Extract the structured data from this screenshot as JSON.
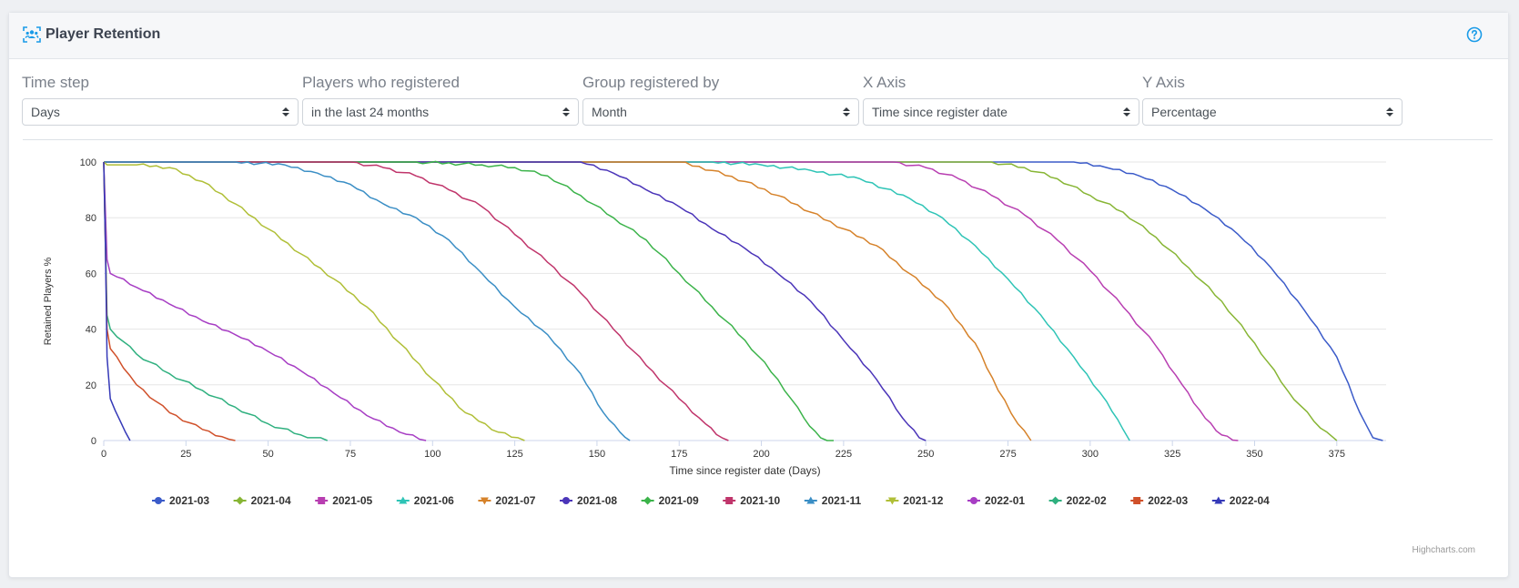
{
  "header": {
    "title": "Player Retention"
  },
  "filters": [
    {
      "label": "Time step",
      "value": "Days"
    },
    {
      "label": "Players who registered",
      "value": "in the last 24 months"
    },
    {
      "label": "Group registered by",
      "value": "Month"
    },
    {
      "label": "X Axis",
      "value": "Time since register date"
    },
    {
      "label": "Y Axis",
      "value": "Percentage"
    }
  ],
  "credits": "Highcharts.com",
  "chart_data": {
    "type": "line",
    "xlabel": "Time since register date (Days)",
    "ylabel": "Retained Players %",
    "xlim": [
      0,
      390
    ],
    "ylim": [
      0,
      100
    ],
    "xticks": [
      0,
      25,
      50,
      75,
      100,
      125,
      150,
      175,
      200,
      225,
      250,
      275,
      300,
      325,
      350,
      375
    ],
    "yticks": [
      0,
      20,
      40,
      60,
      80,
      100
    ],
    "grid": true,
    "legend_position": "bottom",
    "series": [
      {
        "name": "2021-03",
        "color": "#3b5bc9",
        "marker": "circle",
        "points": [
          [
            0,
            100
          ],
          [
            295,
            100
          ],
          [
            305,
            98
          ],
          [
            315,
            95
          ],
          [
            325,
            90
          ],
          [
            335,
            83
          ],
          [
            345,
            74
          ],
          [
            355,
            62
          ],
          [
            365,
            47
          ],
          [
            375,
            30
          ],
          [
            382,
            10
          ],
          [
            386,
            1
          ],
          [
            389,
            0
          ]
        ]
      },
      {
        "name": "2021-04",
        "color": "#87b534",
        "marker": "diamond",
        "points": [
          [
            0,
            100
          ],
          [
            270,
            100
          ],
          [
            280,
            98
          ],
          [
            290,
            94
          ],
          [
            300,
            88
          ],
          [
            310,
            82
          ],
          [
            320,
            73
          ],
          [
            330,
            62
          ],
          [
            340,
            50
          ],
          [
            350,
            35
          ],
          [
            360,
            18
          ],
          [
            368,
            7
          ],
          [
            374,
            1
          ],
          [
            375,
            0
          ]
        ]
      },
      {
        "name": "2021-05",
        "color": "#b83eb1",
        "marker": "square",
        "points": [
          [
            0,
            100
          ],
          [
            240,
            100
          ],
          [
            250,
            98
          ],
          [
            260,
            94
          ],
          [
            270,
            88
          ],
          [
            280,
            81
          ],
          [
            290,
            72
          ],
          [
            300,
            61
          ],
          [
            310,
            48
          ],
          [
            320,
            34
          ],
          [
            328,
            20
          ],
          [
            335,
            8
          ],
          [
            340,
            2
          ],
          [
            345,
            0
          ]
        ]
      },
      {
        "name": "2021-06",
        "color": "#2ec4b6",
        "marker": "triangle",
        "points": [
          [
            0,
            100
          ],
          [
            185,
            100
          ],
          [
            200,
            99
          ],
          [
            215,
            97
          ],
          [
            230,
            94
          ],
          [
            245,
            87
          ],
          [
            255,
            80
          ],
          [
            265,
            70
          ],
          [
            275,
            58
          ],
          [
            285,
            45
          ],
          [
            295,
            30
          ],
          [
            305,
            14
          ],
          [
            310,
            4
          ],
          [
            312,
            0
          ]
        ]
      },
      {
        "name": "2021-07",
        "color": "#d6822a",
        "marker": "triangle-down",
        "points": [
          [
            0,
            100
          ],
          [
            175,
            100
          ],
          [
            185,
            97
          ],
          [
            195,
            93
          ],
          [
            205,
            88
          ],
          [
            215,
            82
          ],
          [
            225,
            76
          ],
          [
            235,
            70
          ],
          [
            245,
            60
          ],
          [
            255,
            50
          ],
          [
            265,
            35
          ],
          [
            272,
            18
          ],
          [
            278,
            6
          ],
          [
            282,
            0
          ]
        ]
      },
      {
        "name": "2021-08",
        "color": "#4b35b9",
        "marker": "circle",
        "points": [
          [
            0,
            100
          ],
          [
            145,
            100
          ],
          [
            155,
            96
          ],
          [
            165,
            90
          ],
          [
            175,
            84
          ],
          [
            185,
            76
          ],
          [
            195,
            69
          ],
          [
            205,
            60
          ],
          [
            215,
            50
          ],
          [
            225,
            36
          ],
          [
            235,
            22
          ],
          [
            243,
            8
          ],
          [
            248,
            1
          ],
          [
            250,
            0
          ]
        ]
      },
      {
        "name": "2021-09",
        "color": "#3bb34a",
        "marker": "diamond",
        "points": [
          [
            0,
            100
          ],
          [
            95,
            100
          ],
          [
            115,
            99
          ],
          [
            125,
            98
          ],
          [
            135,
            95
          ],
          [
            145,
            88
          ],
          [
            155,
            80
          ],
          [
            165,
            72
          ],
          [
            175,
            60
          ],
          [
            185,
            48
          ],
          [
            195,
            36
          ],
          [
            205,
            22
          ],
          [
            213,
            8
          ],
          [
            218,
            1
          ],
          [
            222,
            0
          ]
        ]
      },
      {
        "name": "2021-10",
        "color": "#c0356b",
        "marker": "square",
        "points": [
          [
            0,
            100
          ],
          [
            75,
            100
          ],
          [
            85,
            98
          ],
          [
            95,
            95
          ],
          [
            105,
            90
          ],
          [
            115,
            84
          ],
          [
            125,
            74
          ],
          [
            135,
            64
          ],
          [
            145,
            53
          ],
          [
            155,
            40
          ],
          [
            165,
            27
          ],
          [
            175,
            15
          ],
          [
            183,
            6
          ],
          [
            188,
            1
          ],
          [
            190,
            0
          ]
        ]
      },
      {
        "name": "2021-11",
        "color": "#3a8ec5",
        "marker": "triangle",
        "points": [
          [
            0,
            100
          ],
          [
            40,
            100
          ],
          [
            55,
            99
          ],
          [
            65,
            96
          ],
          [
            75,
            92
          ],
          [
            85,
            85
          ],
          [
            95,
            80
          ],
          [
            105,
            72
          ],
          [
            115,
            60
          ],
          [
            125,
            48
          ],
          [
            135,
            38
          ],
          [
            145,
            24
          ],
          [
            152,
            10
          ],
          [
            157,
            3
          ],
          [
            160,
            0
          ]
        ]
      },
      {
        "name": "2021-12",
        "color": "#b0bf37",
        "marker": "triangle-down",
        "points": [
          [
            0,
            100
          ],
          [
            1,
            99
          ],
          [
            10,
            99
          ],
          [
            20,
            98
          ],
          [
            30,
            93
          ],
          [
            40,
            85
          ],
          [
            50,
            76
          ],
          [
            60,
            67
          ],
          [
            70,
            58
          ],
          [
            80,
            48
          ],
          [
            90,
            35
          ],
          [
            100,
            22
          ],
          [
            110,
            10
          ],
          [
            120,
            3
          ],
          [
            128,
            0
          ]
        ]
      },
      {
        "name": "2022-01",
        "color": "#a73ec4",
        "marker": "circle",
        "points": [
          [
            0,
            100
          ],
          [
            1,
            65
          ],
          [
            2,
            60
          ],
          [
            10,
            55
          ],
          [
            20,
            49
          ],
          [
            30,
            43
          ],
          [
            40,
            38
          ],
          [
            50,
            32
          ],
          [
            60,
            25
          ],
          [
            70,
            17
          ],
          [
            80,
            9
          ],
          [
            90,
            3
          ],
          [
            98,
            0
          ]
        ]
      },
      {
        "name": "2022-02",
        "color": "#2fb07f",
        "marker": "diamond",
        "points": [
          [
            0,
            100
          ],
          [
            1,
            45
          ],
          [
            2,
            40
          ],
          [
            10,
            31
          ],
          [
            20,
            24
          ],
          [
            30,
            18
          ],
          [
            40,
            12
          ],
          [
            50,
            6
          ],
          [
            60,
            2
          ],
          [
            68,
            0
          ]
        ]
      },
      {
        "name": "2022-03",
        "color": "#d0502a",
        "marker": "square",
        "points": [
          [
            0,
            100
          ],
          [
            1,
            40
          ],
          [
            2,
            33
          ],
          [
            10,
            20
          ],
          [
            20,
            10
          ],
          [
            30,
            4
          ],
          [
            38,
            0.5
          ],
          [
            40,
            0
          ]
        ]
      },
      {
        "name": "2022-04",
        "color": "#3539b8",
        "marker": "triangle",
        "points": [
          [
            0,
            100
          ],
          [
            0.5,
            70
          ],
          [
            1,
            30
          ],
          [
            2,
            15
          ],
          [
            5,
            7
          ],
          [
            8,
            0
          ]
        ]
      }
    ]
  },
  "icons": {
    "title": "users-icon",
    "help": "help-circle-icon",
    "select_caret": "select-arrows-icon"
  },
  "colors": {
    "accent": "#1a9be8",
    "grid": "#e6e6e6"
  }
}
